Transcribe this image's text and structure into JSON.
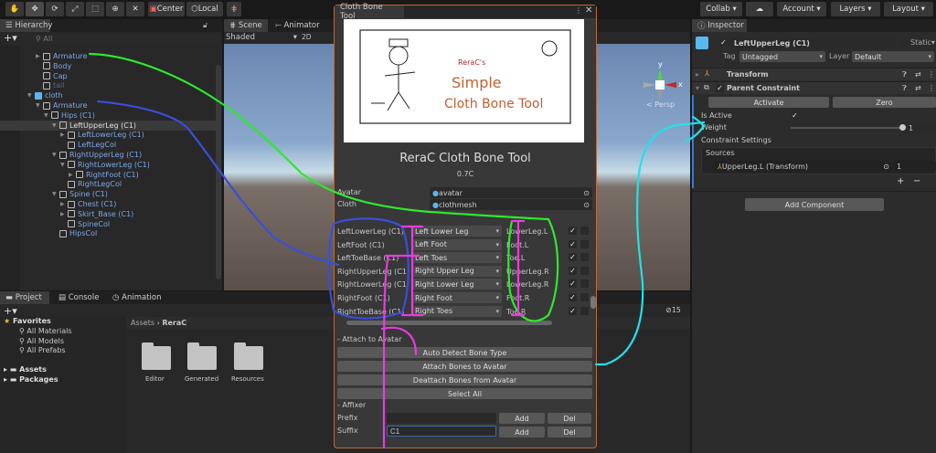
{
  "toolbar": {
    "tools": [
      "hand-tool",
      "move-tool",
      "rotate-tool",
      "scale-tool",
      "rect-tool",
      "transform-tool",
      "custom-tool"
    ],
    "center_label": "Center",
    "local_label": "Local",
    "collab_label": "Collab",
    "account_label": "Account",
    "layers_label": "Layers",
    "layout_label": "Layout"
  },
  "hierarchy": {
    "tab_label": "Hierarchy",
    "search_placeholder": "All",
    "items": [
      {
        "label": "Armature",
        "depth": 1,
        "arrow": "collapsed"
      },
      {
        "label": "Body",
        "depth": 1,
        "arrow": "none"
      },
      {
        "label": "Cap",
        "depth": 1,
        "arrow": "none"
      },
      {
        "label": "tail",
        "depth": 1,
        "arrow": "none",
        "disabled": true
      },
      {
        "label": "cloth",
        "depth": 0,
        "arrow": "expanded",
        "prefab": true
      },
      {
        "label": "Armature",
        "depth": 1,
        "arrow": "expanded"
      },
      {
        "label": "Hips (C1)",
        "depth": 2,
        "arrow": "expanded"
      },
      {
        "label": "LeftUpperLeg (C1)",
        "depth": 3,
        "arrow": "expanded",
        "selected": true
      },
      {
        "label": "LeftLowerLeg (C1)",
        "depth": 4,
        "arrow": "collapsed"
      },
      {
        "label": "LeftLegCol",
        "depth": 4,
        "arrow": "none"
      },
      {
        "label": "RightUpperLeg (C1)",
        "depth": 3,
        "arrow": "expanded"
      },
      {
        "label": "RightLowerLeg (C1)",
        "depth": 4,
        "arrow": "expanded"
      },
      {
        "label": "RightFoot (C1)",
        "depth": 5,
        "arrow": "collapsed"
      },
      {
        "label": "RightLegCol",
        "depth": 4,
        "arrow": "none"
      },
      {
        "label": "Spine (C1)",
        "depth": 3,
        "arrow": "expanded"
      },
      {
        "label": "Chest (C1)",
        "depth": 4,
        "arrow": "collapsed"
      },
      {
        "label": "Skirt_Base (C1)",
        "depth": 4,
        "arrow": "collapsed"
      },
      {
        "label": "SpineCol",
        "depth": 4,
        "arrow": "none"
      },
      {
        "label": "HipsCol",
        "depth": 3,
        "arrow": "none"
      }
    ]
  },
  "scene": {
    "tabs": [
      "Scene",
      "Animator"
    ],
    "shading": "Shaded",
    "mode_2d": "2D",
    "gizmo_y": "y",
    "gizmo_x": "x",
    "projection": "Persp"
  },
  "project": {
    "tabs": [
      "Project",
      "Console",
      "Animation"
    ],
    "favorites_label": "Favorites",
    "favorites": [
      "All Materials",
      "All Models",
      "All Prefabs"
    ],
    "roots": [
      "Assets",
      "Packages"
    ],
    "breadcrumb": [
      "Assets",
      "ReraC"
    ],
    "folders": [
      "Editor",
      "Generated",
      "Resources"
    ],
    "hidden_count": "15"
  },
  "tool": {
    "window_title": "Cloth Bone Tool",
    "logo_text": [
      "ReraC's",
      "Simple",
      "Cloth Bone Tool"
    ],
    "title": "ReraC Cloth Bone Tool",
    "version": "0.7C",
    "avatar_label": "Avatar",
    "avatar_value": "avatar",
    "cloth_label": "Cloth",
    "cloth_value": "clothmesh",
    "bones": [
      {
        "name": "LeftLowerLeg (C1)",
        "type": "Left Lower Leg",
        "target": "LowerLeg.L",
        "checked": true
      },
      {
        "name": "LeftFoot (C1)",
        "type": "Left Foot",
        "target": "Foot.L",
        "checked": true
      },
      {
        "name": "LeftToeBase (C1)",
        "type": "Left Toes",
        "target": "Toe.L",
        "checked": true
      },
      {
        "name": "RightUpperLeg (C1)",
        "type": "Right Upper Leg",
        "target": "UpperLeg.R",
        "checked": true
      },
      {
        "name": "RightLowerLeg (C1)",
        "type": "Right Lower Leg",
        "target": "LowerLeg.R",
        "checked": true
      },
      {
        "name": "RightFoot (C1)",
        "type": "Right Foot",
        "target": "Foot.R",
        "checked": true
      },
      {
        "name": "RightToeBase (C1)",
        "type": "Right Toes",
        "target": "Toe.R",
        "checked": true
      }
    ],
    "attach_header": "- Attach to Avatar",
    "buttons": [
      "Auto Detect Bone Type",
      "Attach Bones to Avatar",
      "Deattach Bones from Avatar",
      "Select All"
    ],
    "affixer_header": "- Affixer",
    "prefix_label": "Prefix",
    "prefix_value": "",
    "suffix_label": "Suffix",
    "suffix_value": "C1",
    "add_label": "Add",
    "del_label": "Del"
  },
  "inspector": {
    "tab_label": "Inspector",
    "object_name": "LeftUpperLeg (C1)",
    "active": true,
    "static_label": "Static",
    "tag_label": "Tag",
    "tag_value": "Untagged",
    "layer_label": "Layer",
    "layer_value": "Default",
    "components": [
      "Transform",
      "Parent Constraint"
    ],
    "activate_label": "Activate",
    "zero_label": "Zero",
    "is_active_label": "Is Active",
    "is_active": true,
    "weight_label": "Weight",
    "weight_value": "1",
    "weight_fraction": 1,
    "constraint_settings_label": "Constraint Settings",
    "sources_label": "Sources",
    "source_value": "UpperLeg.L (Transform)",
    "source_weight": "1",
    "add_component_label": "Add Component"
  },
  "annotation_colors": {
    "green": "#2ee82e",
    "blue": "#3a4fd8",
    "magenta": "#e83ce0",
    "cyan": "#22e0e8"
  },
  "colors": {
    "panel": "#282828",
    "window_border": "#c0703a",
    "selection": "#3a3a3a",
    "link_blue": "#7ca8e8"
  }
}
